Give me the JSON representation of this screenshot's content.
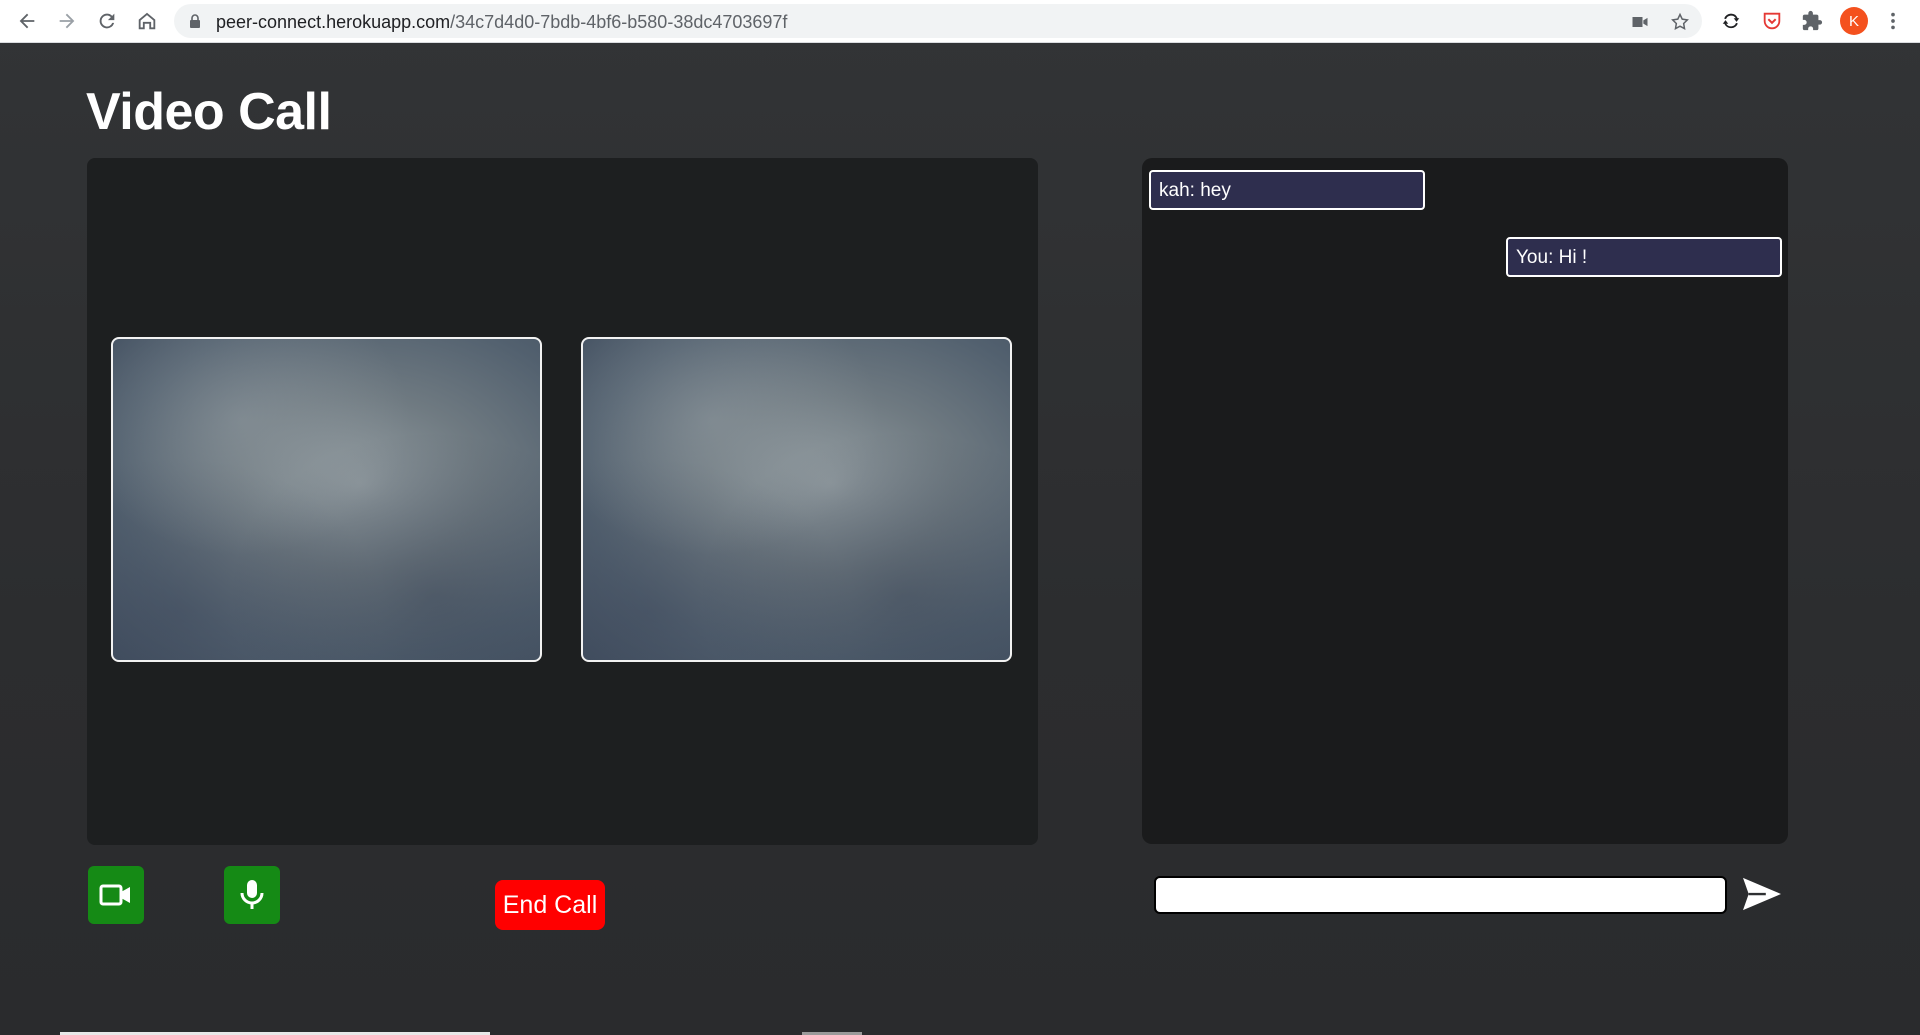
{
  "browser": {
    "url_host": "peer-connect.herokuapp.com",
    "url_path": "/34c7d4d0-7bdb-4bf6-b580-38dc4703697f",
    "profile_initial": "K",
    "icons": {
      "back": "arrow-left-icon",
      "forward": "arrow-right-icon",
      "reload": "reload-icon",
      "home": "home-icon",
      "lock": "lock-icon",
      "camera": "camera-icon",
      "bookmark": "star-icon",
      "sync": "sync-icon",
      "pocket": "pocket-icon",
      "extensions": "puzzle-icon",
      "menu": "kebab-menu-icon"
    }
  },
  "page": {
    "title": "Video Call"
  },
  "video": {
    "tiles": [
      "remote-video",
      "local-video"
    ]
  },
  "controls": {
    "camera_icon": "video-camera-icon",
    "mic_icon": "microphone-icon",
    "end_call_label": "End Call"
  },
  "chat": {
    "messages": [
      {
        "text": "kah: hey",
        "side": "left"
      },
      {
        "text": "You: Hi !",
        "side": "right"
      }
    ],
    "input_value": "",
    "send_icon": "send-arrow-icon"
  },
  "colors": {
    "background": "#2e3032",
    "panel": "#1d1f20",
    "control_green": "#158a15",
    "end_call_red": "#ff0000",
    "message_bg": "#2e2e4e",
    "avatar": "#f4511e"
  }
}
